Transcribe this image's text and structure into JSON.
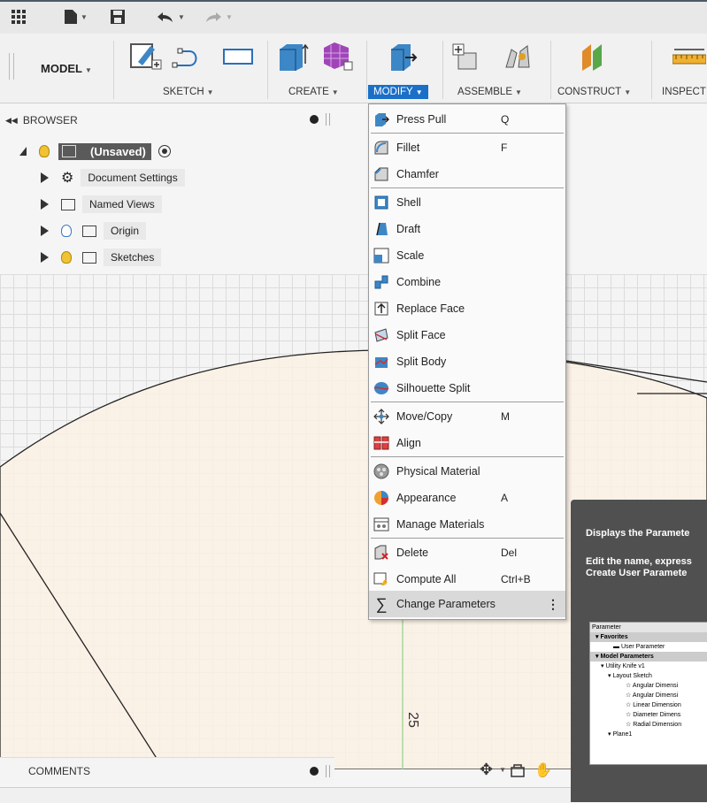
{
  "toolbar": {
    "workspace": "MODEL",
    "groups": [
      "SKETCH",
      "CREATE",
      "MODIFY",
      "ASSEMBLE",
      "CONSTRUCT",
      "INSPECT"
    ]
  },
  "browser": {
    "title": "BROWSER",
    "root": "(Unsaved)",
    "items": [
      "Document Settings",
      "Named Views",
      "Origin",
      "Sketches"
    ]
  },
  "modify_menu": {
    "items": [
      {
        "label": "Press Pull",
        "key": "Q"
      },
      {
        "label": "Fillet",
        "key": "F"
      },
      {
        "label": "Chamfer",
        "key": ""
      },
      {
        "label": "Shell",
        "key": ""
      },
      {
        "label": "Draft",
        "key": ""
      },
      {
        "label": "Scale",
        "key": ""
      },
      {
        "label": "Combine",
        "key": ""
      },
      {
        "label": "Replace Face",
        "key": ""
      },
      {
        "label": "Split Face",
        "key": ""
      },
      {
        "label": "Split Body",
        "key": ""
      },
      {
        "label": "Silhouette Split",
        "key": ""
      },
      {
        "label": "Move/Copy",
        "key": "M"
      },
      {
        "label": "Align",
        "key": ""
      },
      {
        "label": "Physical Material",
        "key": ""
      },
      {
        "label": "Appearance",
        "key": "A"
      },
      {
        "label": "Manage Materials",
        "key": ""
      },
      {
        "label": "Delete",
        "key": "Del"
      },
      {
        "label": "Compute All",
        "key": "Ctrl+B"
      },
      {
        "label": "Change Parameters",
        "key": ""
      }
    ],
    "more": "⋮"
  },
  "canvas": {
    "dimension_label": "25"
  },
  "tooltip": {
    "line1": "Displays the Paramete",
    "line2a": "Edit the name, express",
    "line2b": "Create User Paramete",
    "image_rows": [
      "Parameter",
      "Favorites",
      "User Parameter",
      "Model Parameters",
      "Utility Knife v1",
      "Layout Sketch",
      "Angular Dimensi",
      "Angular Dimensi",
      "Linear Dimension",
      "Diameter Dimens",
      "Radial Dimension",
      "Plane1"
    ]
  },
  "comments": {
    "title": "COMMENTS"
  },
  "colors": {
    "accent": "#1a6fc8",
    "highlight": "#d9d9d9",
    "tooltip": "#505050",
    "shape_fill": "#fdf1e4"
  }
}
